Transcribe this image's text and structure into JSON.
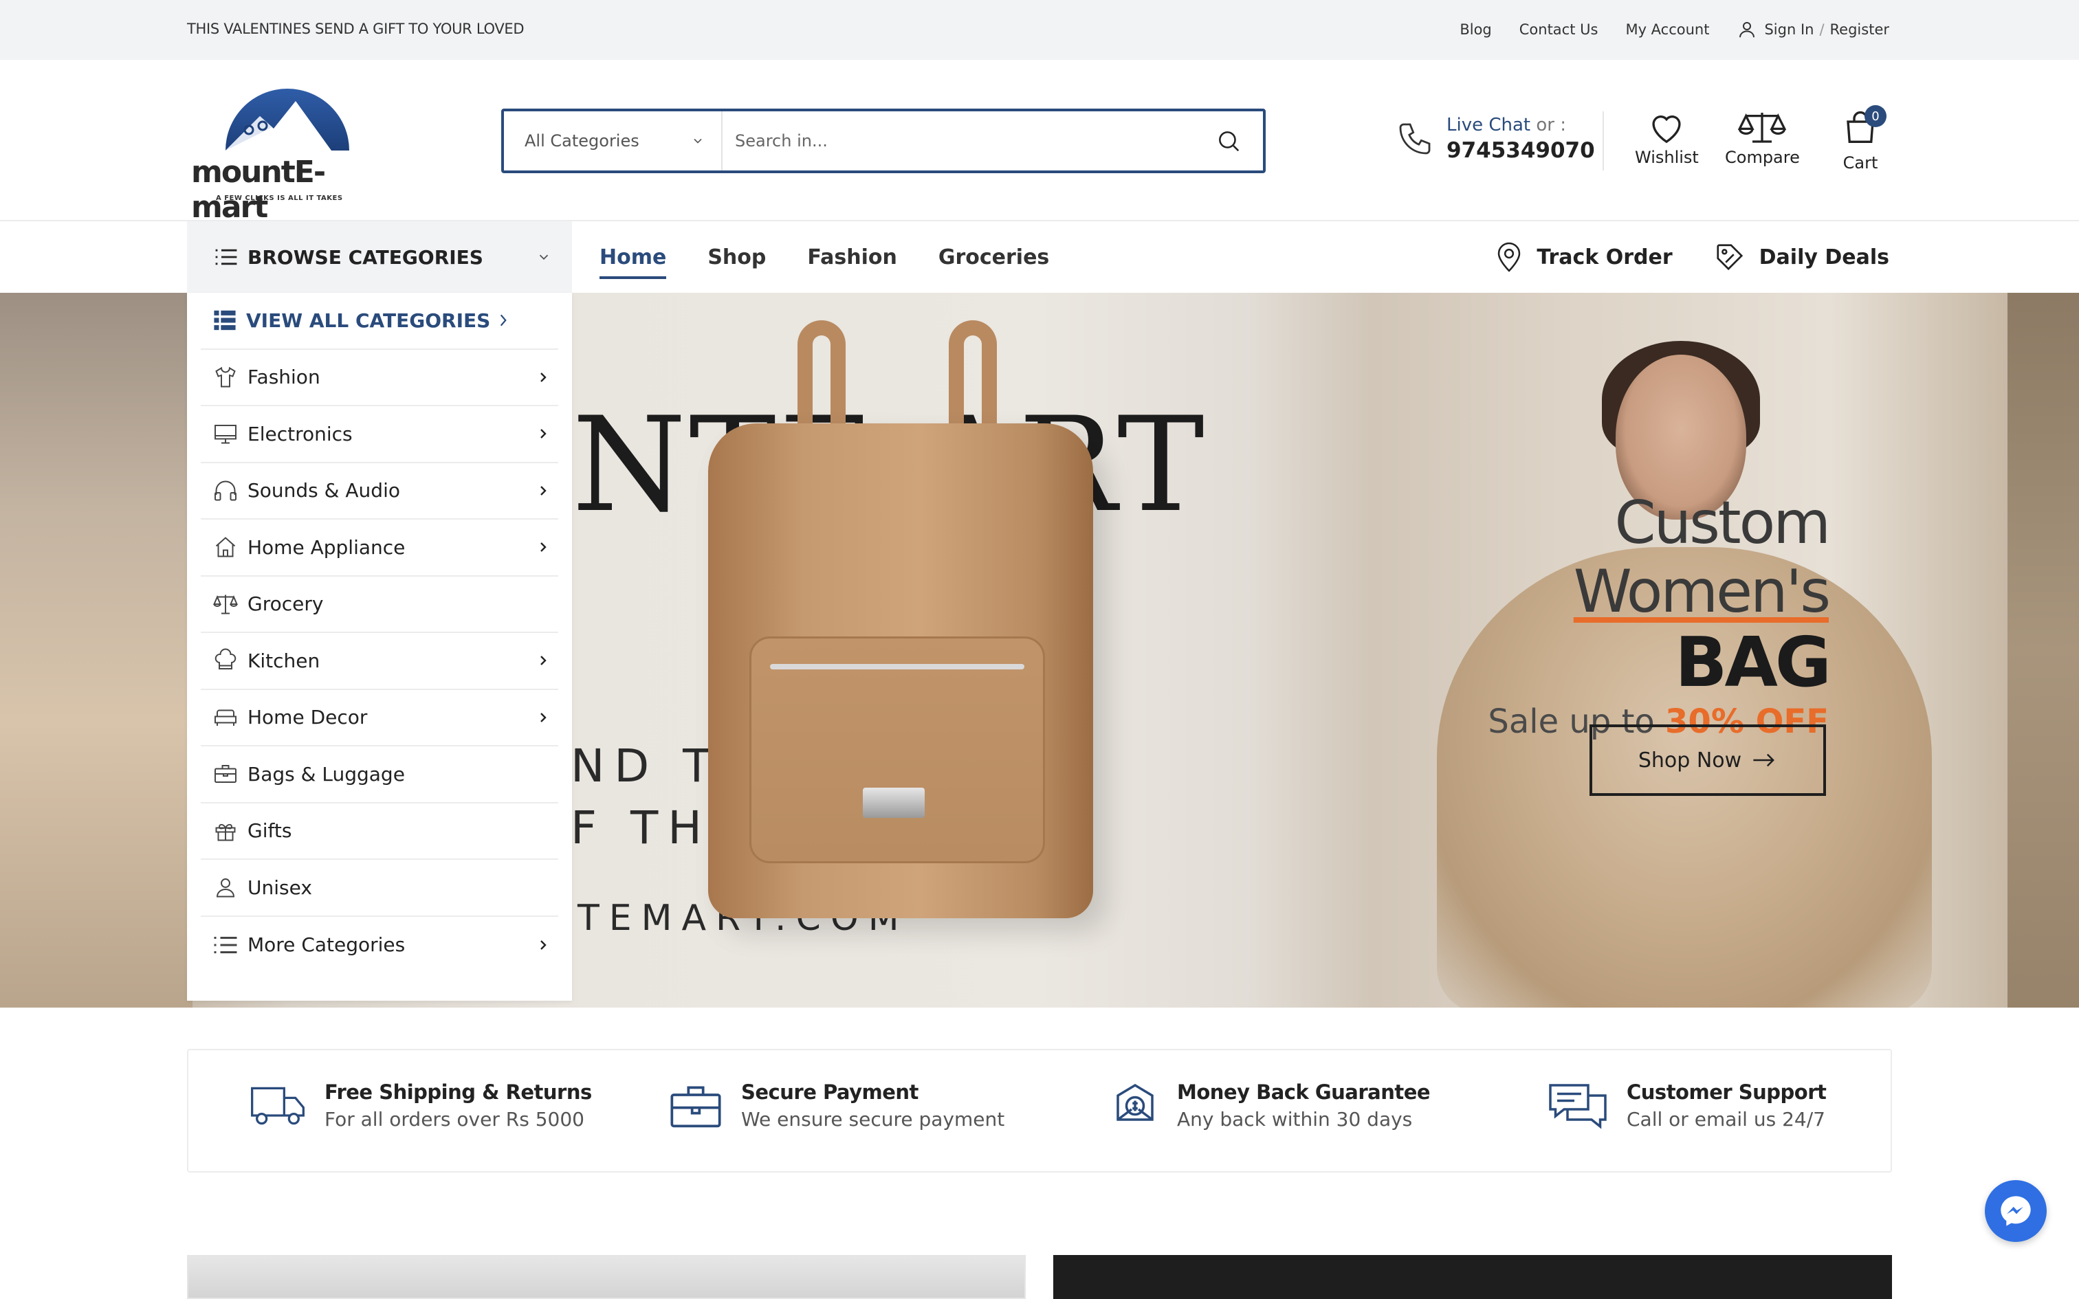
{
  "topbar": {
    "promo": "THIS VALENTINES SEND A GIFT TO YOUR LOVED",
    "links": [
      "Blog",
      "Contact Us",
      "My Account"
    ],
    "sign_in": "Sign In",
    "divider": "/",
    "register": "Register"
  },
  "brand": {
    "name": "mountE-mart",
    "tagline": "A FEW CLICKS IS ALL IT TAKES"
  },
  "search": {
    "category": "All Categories",
    "placeholder": "Search in..."
  },
  "contact": {
    "live_chat": "Live Chat",
    "or": "or :",
    "phone": "9745349070"
  },
  "header_icons": {
    "wishlist": "Wishlist",
    "compare": "Compare",
    "cart": "Cart",
    "cart_count": "0"
  },
  "nav": {
    "browse": "BROWSE CATEGORIES",
    "links": [
      "Home",
      "Shop",
      "Fashion",
      "Groceries"
    ],
    "active": "Home",
    "track_order": "Track Order",
    "daily_deals": "Daily Deals"
  },
  "categories": {
    "view_all": "VIEW ALL CATEGORIES",
    "items": [
      {
        "label": "Fashion",
        "icon": "tshirt-icon",
        "has_sub": true
      },
      {
        "label": "Electronics",
        "icon": "monitor-icon",
        "has_sub": true
      },
      {
        "label": "Sounds & Audio",
        "icon": "headphones-icon",
        "has_sub": true
      },
      {
        "label": "Home Appliance",
        "icon": "home-icon",
        "has_sub": true
      },
      {
        "label": "Grocery",
        "icon": "scale-icon",
        "has_sub": false
      },
      {
        "label": "Kitchen",
        "icon": "chef-hat-icon",
        "has_sub": true
      },
      {
        "label": "Home Decor",
        "icon": "sofa-icon",
        "has_sub": true
      },
      {
        "label": "Bags & Luggage",
        "icon": "briefcase-icon",
        "has_sub": false
      },
      {
        "label": "Gifts",
        "icon": "gift-icon",
        "has_sub": false
      },
      {
        "label": "Unisex",
        "icon": "user-icon",
        "has_sub": false
      },
      {
        "label": "More Categories",
        "icon": "list-icon",
        "has_sub": true
      }
    ]
  },
  "hero": {
    "bg_text_1": "NTE  ART",
    "bg_text_2": "ND TA",
    "bg_text_3": "F THE",
    "bg_url": "TEMART.COM",
    "line1_a": "Custom ",
    "line1_b": "Women's",
    "line2": "BAG",
    "line3_a": "Sale up to ",
    "line3_b": "30% OFF",
    "cta": "Shop Now",
    "accent": "#e86c2a"
  },
  "features": [
    {
      "title": "Free Shipping & Returns",
      "sub": "For all orders over Rs 5000",
      "icon": "truck-icon"
    },
    {
      "title": "Secure Payment",
      "sub": "We ensure secure payment",
      "icon": "briefcase-icon"
    },
    {
      "title": "Money Back Guarantee",
      "sub": "Any back within 30 days",
      "icon": "money-back-icon"
    },
    {
      "title": "Customer Support",
      "sub": "Call or email us 24/7",
      "icon": "chat-icon"
    }
  ],
  "colors": {
    "brand": "#2a4b7c",
    "accent": "#e86c2a",
    "messenger": "#2f6fe3"
  }
}
